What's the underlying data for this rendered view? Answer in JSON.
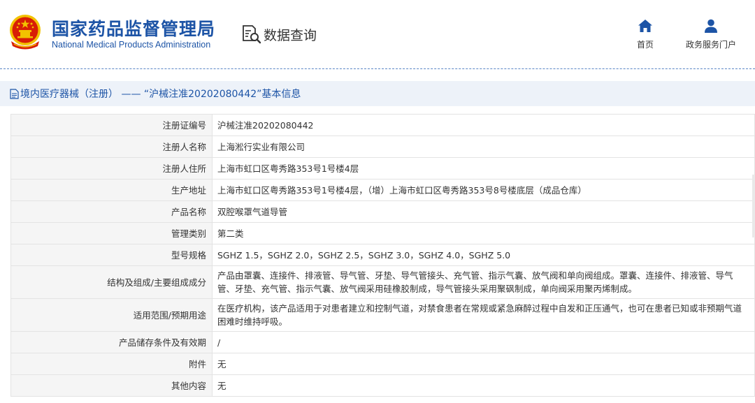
{
  "header": {
    "brand_cn": "国家药品监督管理局",
    "brand_en": "National Medical Products Administration",
    "data_query_label": "数据查询",
    "nav": {
      "home_label": "首页",
      "home_icon": "home-icon",
      "portal_label": "政务服务门户",
      "portal_icon": "user-icon"
    },
    "colors": {
      "brand": "#1d54a6",
      "emblem_red": "#d81e06",
      "emblem_gold": "#f2c200"
    }
  },
  "breadcrumb": {
    "icon": "document-icon",
    "text": "境内医疗器械（注册） —— “沪械注准20202080442”基本信息"
  },
  "record": {
    "rows": [
      {
        "label": "注册证编号",
        "value": "沪械注准20202080442"
      },
      {
        "label": "注册人名称",
        "value": "上海淞行实业有限公司"
      },
      {
        "label": "注册人住所",
        "value": "上海市虹口区粤秀路353号1号楼4层"
      },
      {
        "label": "生产地址",
        "value": "上海市虹口区粤秀路353号1号楼4层，（增）上海市虹口区粤秀路353号8号楼底层（成品仓库）"
      },
      {
        "label": "产品名称",
        "value": "双腔喉罩气道导管"
      },
      {
        "label": "管理类别",
        "value": "第二类"
      },
      {
        "label": "型号规格",
        "value": "SGHZ 1.5，SGHZ 2.0，SGHZ 2.5，SGHZ 3.0，SGHZ 4.0，SGHZ 5.0"
      },
      {
        "label": "结构及组成/主要组成成分",
        "value": "产品由罩囊、连接件、排液管、导气管、牙垫、导气管接头、充气管、指示气囊、放气阀和单向阀组成。罩囊、连接件、排液管、导气管、牙垫、充气管、指示气囊、放气阀采用硅橡胶制成，导气管接头采用聚砜制成，单向阀采用聚丙烯制成。"
      },
      {
        "label": "适用范围/预期用途",
        "value": "在医疗机构，该产品适用于对患者建立和控制气道，对禁食患者在常规或紧急麻醉过程中自发和正压通气，也可在患者已知或非预期气道困难时维持呼吸。"
      },
      {
        "label": "产品储存条件及有效期",
        "value": "/"
      },
      {
        "label": "附件",
        "value": "无"
      },
      {
        "label": "其他内容",
        "value": "无"
      }
    ]
  }
}
